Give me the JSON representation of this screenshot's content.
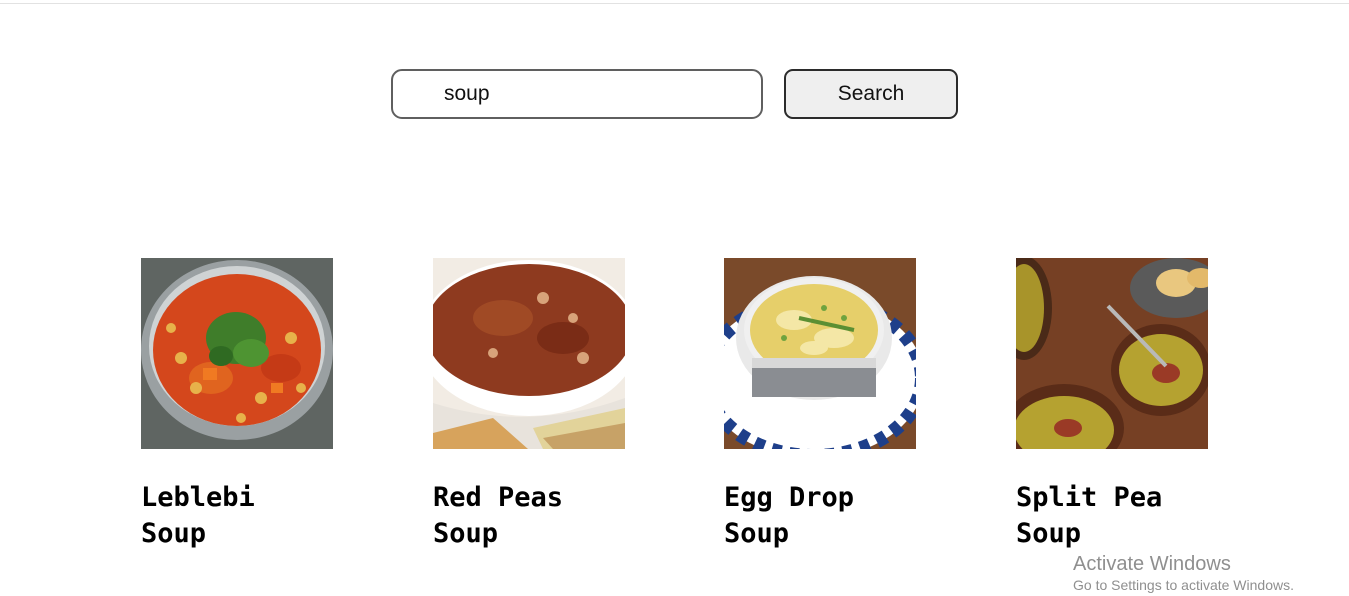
{
  "search": {
    "value": "soup",
    "button_label": "Search"
  },
  "results": [
    {
      "title": "Leblebi\nSoup",
      "image_icon": "leblebi-soup-photo"
    },
    {
      "title": "Red Peas\nSoup",
      "image_icon": "red-peas-soup-photo"
    },
    {
      "title": "Egg Drop\nSoup",
      "image_icon": "egg-drop-soup-photo"
    },
    {
      "title": "Split Pea\nSoup",
      "image_icon": "split-pea-soup-photo"
    }
  ],
  "watermark": {
    "title": "Activate Windows",
    "subtitle": "Go to Settings to activate Windows."
  }
}
